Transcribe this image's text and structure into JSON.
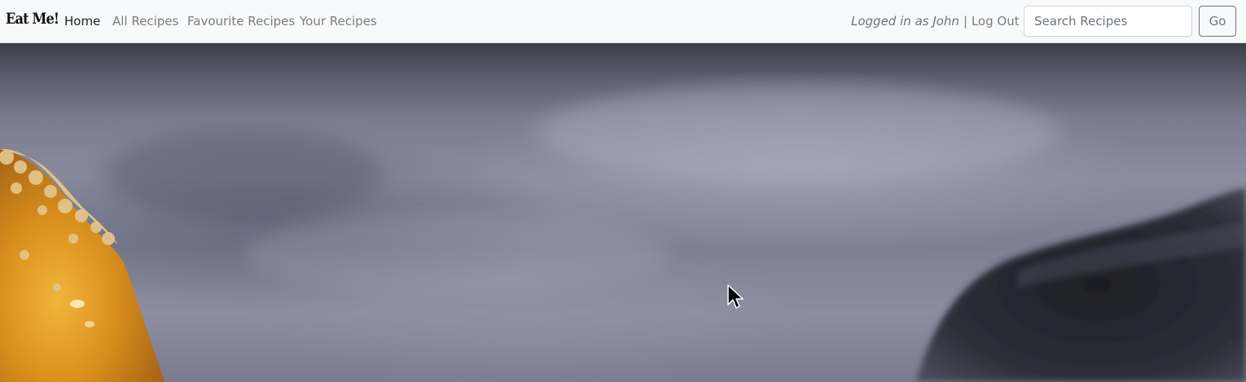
{
  "brand": {
    "name": "Eat Me!"
  },
  "nav": {
    "items": [
      {
        "label": "Home",
        "active": true
      },
      {
        "label": "All Recipes",
        "active": false
      },
      {
        "label": "Favourite Recipes",
        "active": false
      },
      {
        "label": "Your Recipes",
        "active": false
      }
    ]
  },
  "user": {
    "logged_in_text": "Logged in as John",
    "logout_label": "| Log Out"
  },
  "search": {
    "placeholder": "Search Recipes",
    "value": "",
    "button_label": "Go"
  },
  "colors": {
    "navbar_bg": "#f8f9fa",
    "link_muted": "#7c7c7c",
    "link_active": "#222222"
  }
}
